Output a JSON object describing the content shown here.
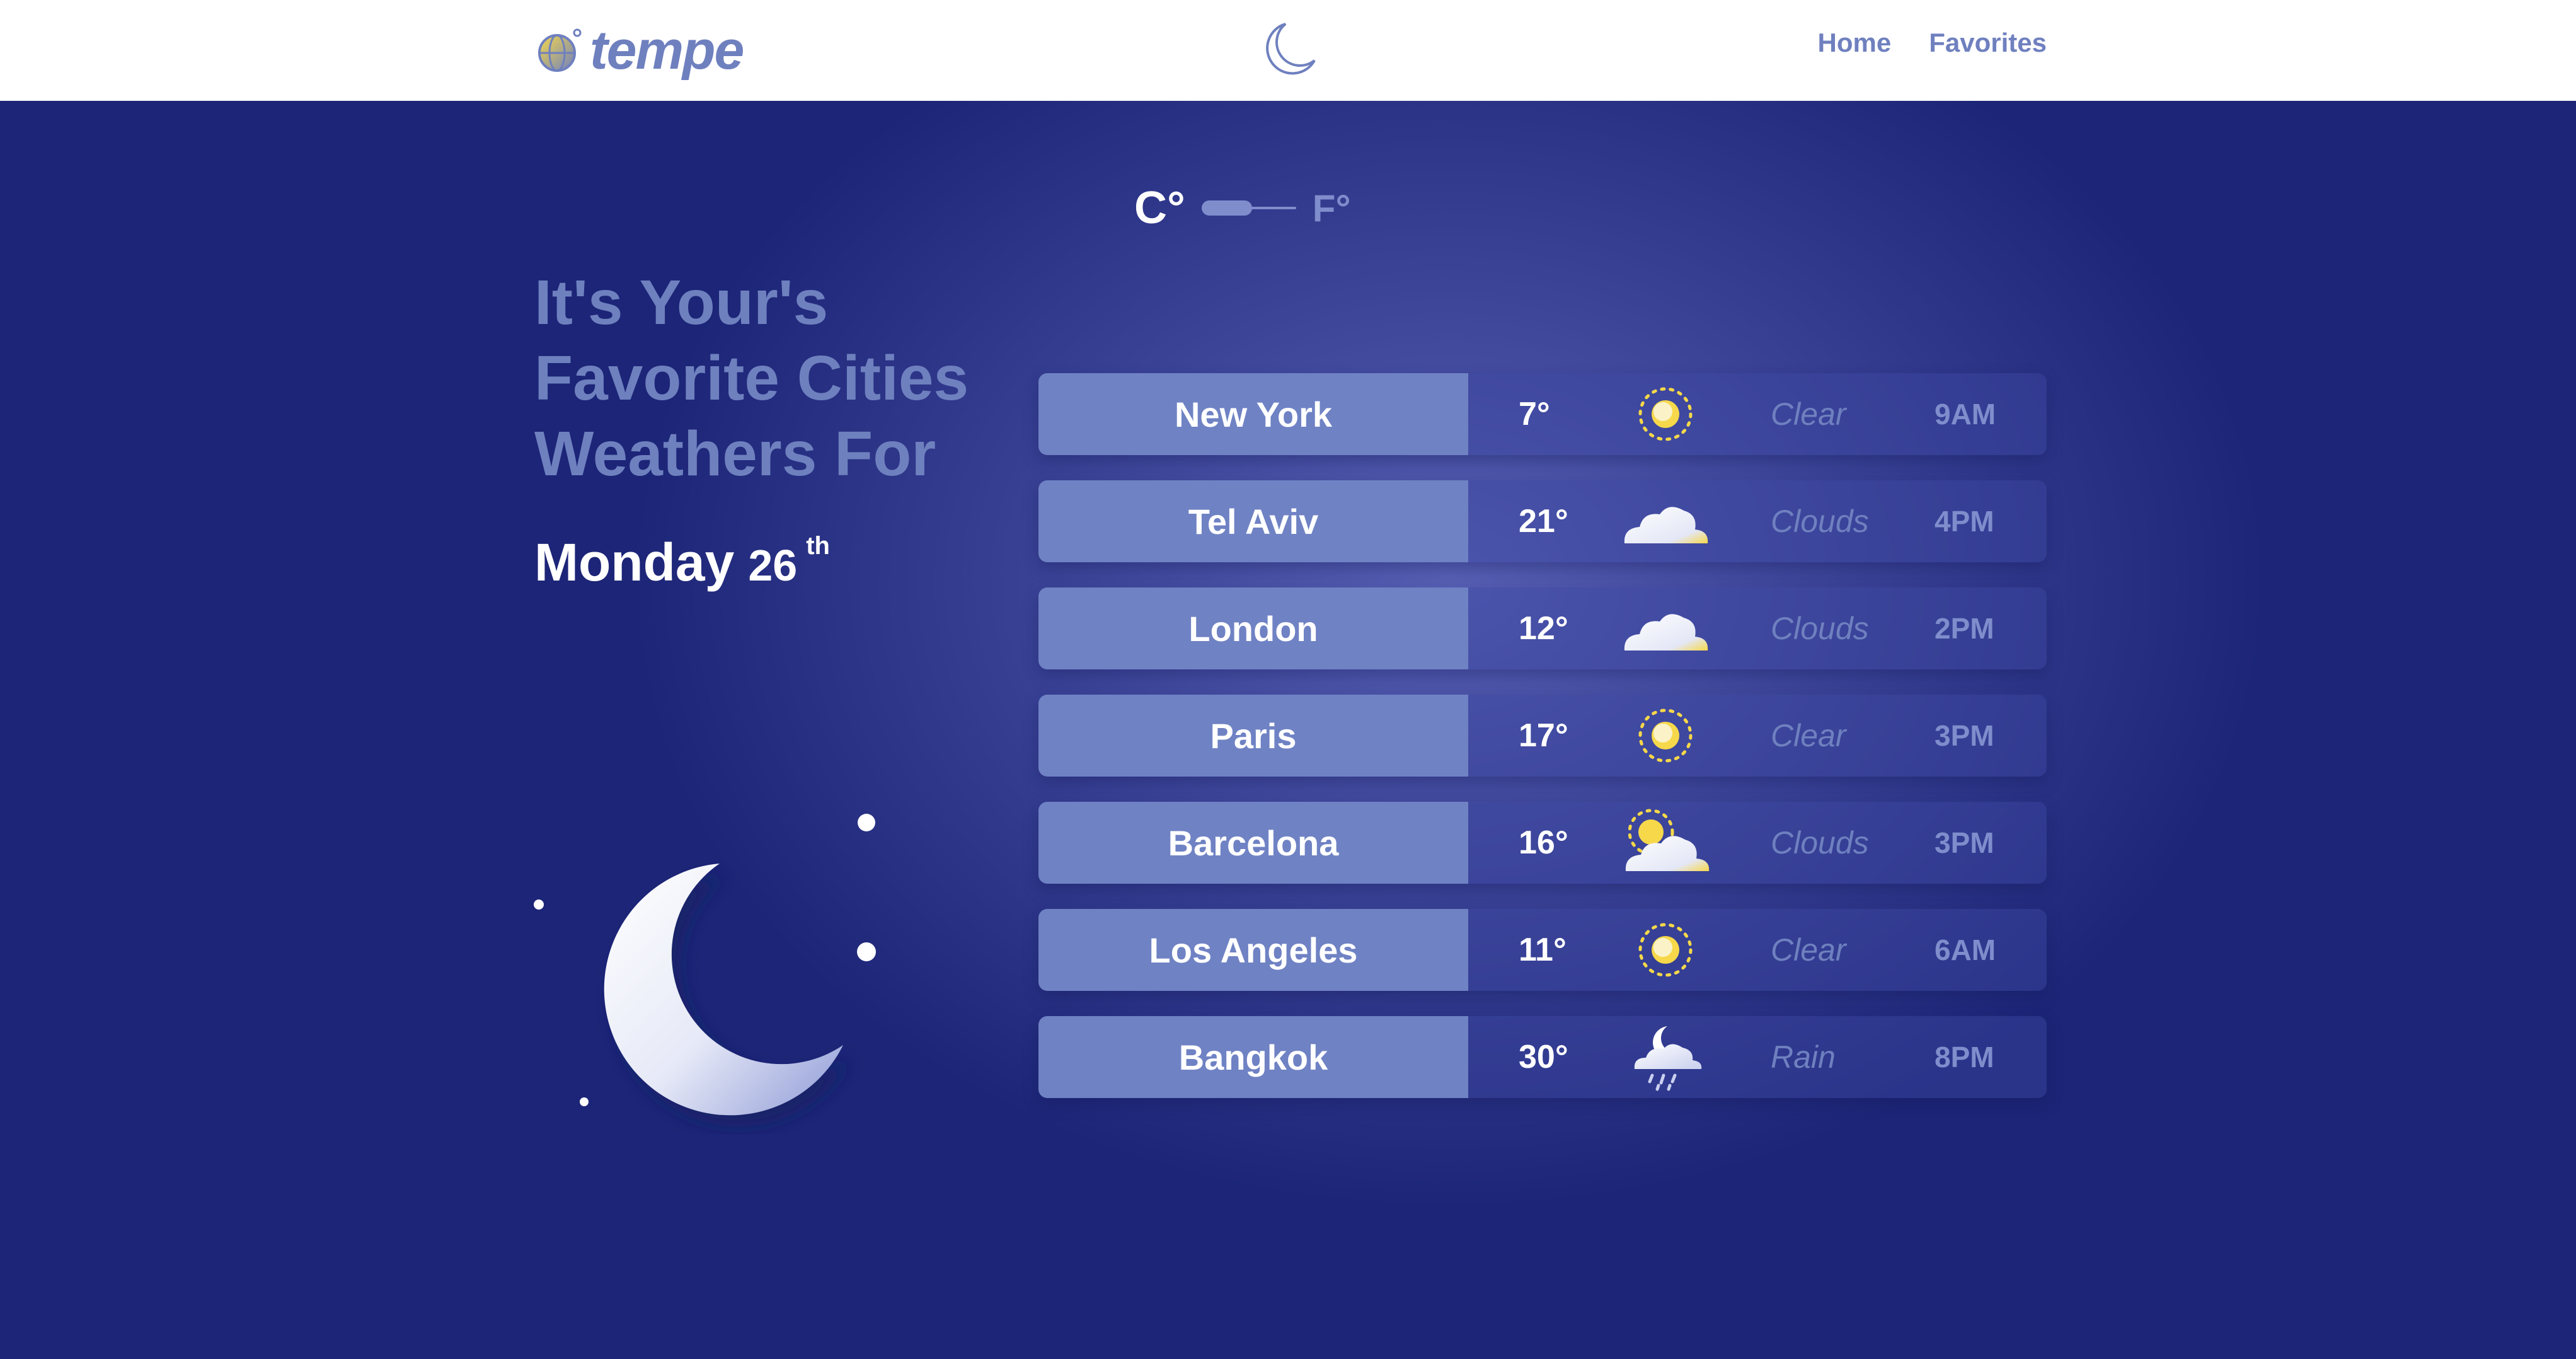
{
  "nav": {
    "logo_text": "tempe",
    "links": [
      {
        "label": "Home"
      },
      {
        "label": "Favorites"
      }
    ]
  },
  "hero": {
    "headline": "It's Your's Favorite Cities Weathers For",
    "day": "Monday",
    "date_num": "26",
    "date_suffix": "th"
  },
  "units": {
    "celsius": "C°",
    "fahrenheit": "F°",
    "selected": "C°"
  },
  "cities": [
    {
      "name": "New York",
      "temp": "7°",
      "condition": "Clear",
      "time": "9AM",
      "icon": "sun-icon"
    },
    {
      "name": "Tel Aviv",
      "temp": "21°",
      "condition": "Clouds",
      "time": "4PM",
      "icon": "cloud-icon"
    },
    {
      "name": "London",
      "temp": "12°",
      "condition": "Clouds",
      "time": "2PM",
      "icon": "cloud-icon"
    },
    {
      "name": "Paris",
      "temp": "17°",
      "condition": "Clear",
      "time": "3PM",
      "icon": "sun-icon"
    },
    {
      "name": "Barcelona",
      "temp": "16°",
      "condition": "Clouds",
      "time": "3PM",
      "icon": "sun-cloud-icon"
    },
    {
      "name": "Los Angeles",
      "temp": "11°",
      "condition": "Clear",
      "time": "6AM",
      "icon": "sun-icon"
    },
    {
      "name": "Bangkok",
      "temp": "30°",
      "condition": "Rain",
      "time": "8PM",
      "icon": "moon-rain-icon"
    }
  ],
  "colors": {
    "accent": "#6f80bf",
    "background_dark": "#1c2577",
    "background_light": "#5860b5",
    "sun": "#f6d84a"
  }
}
